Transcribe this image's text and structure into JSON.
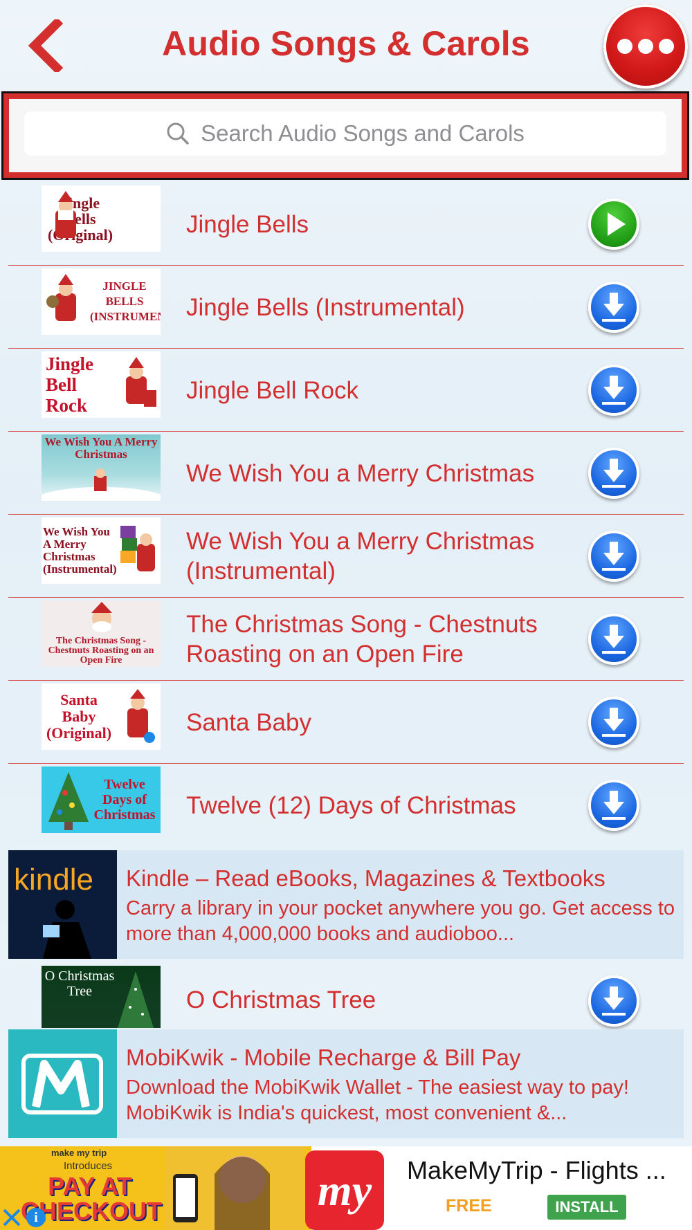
{
  "header": {
    "title": "Audio Songs & Carols",
    "back_icon": "chevron-left-icon",
    "menu_icon": "more-horizontal-icon"
  },
  "search": {
    "placeholder": "Search Audio Songs and Carols",
    "icon": "search-icon"
  },
  "songs_a": [
    {
      "title": "Jingle Bells",
      "thumb_text": "Jingle Bells (Original)",
      "action": "play-icon"
    },
    {
      "title": "Jingle Bells (Instrumental)",
      "thumb_text": "JINGLE BELLS (INSTRUMENTAL)",
      "action": "download-icon"
    },
    {
      "title": "Jingle Bell Rock",
      "thumb_text": "Jingle Bell Rock",
      "action": "download-icon"
    },
    {
      "title": "We Wish You a Merry Christmas",
      "thumb_text": "We Wish You A Merry Christmas",
      "action": "download-icon"
    },
    {
      "title": "We Wish You a Merry Christmas (Instrumental)",
      "thumb_text": "We Wish You A Merry Christmas (Instrumental)",
      "action": "download-icon"
    },
    {
      "title": "The Christmas Song - Chestnuts Roasting on an Open Fire",
      "thumb_text": "The Christmas Song - Chestnuts Roasting on an Open Fire",
      "action": "download-icon"
    },
    {
      "title": "Santa Baby",
      "thumb_text": "Santa Baby (Original)",
      "action": "download-icon"
    },
    {
      "title": "Twelve (12) Days of Christmas",
      "thumb_text": "Twelve Days of Christmas",
      "action": "download-icon"
    }
  ],
  "ads": [
    {
      "title": "Kindle – Read eBooks, Magazines & Textbooks",
      "description": "Carry a library in your pocket anywhere you go. Get access to more than 4,000,000 books and audioboo...",
      "logo_text": "kindle"
    },
    {
      "title": "MobiKwik - Mobile Recharge & Bill Pay",
      "description": "Download the MobiKwik Wallet - The easiest way to pay! MobiKwik is India's quickest, most convenient &..."
    }
  ],
  "songs_b": [
    {
      "title": "O Christmas Tree",
      "thumb_text": "O Christmas Tree",
      "action": "download-icon"
    }
  ],
  "banner": {
    "title": "MakeMyTrip - Flights ...",
    "price": "FREE",
    "install_label": "INSTALL",
    "promo_brand": "make my trip",
    "promo_intro": "Introduces",
    "promo_text": "PAY AT CHECKOUT",
    "logo_text": "my"
  },
  "colors": {
    "accent_red": "#d32f2f",
    "download_blue": "#1a66e0",
    "play_green": "#1f9a14"
  }
}
